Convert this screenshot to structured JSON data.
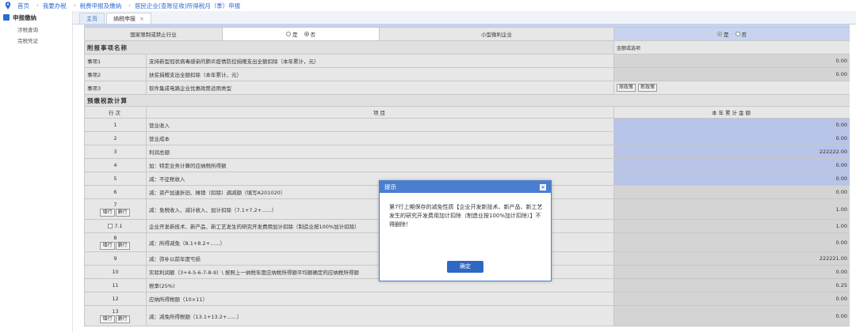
{
  "breadcrumb": [
    "首页",
    "我要办税",
    "税费申报及缴纳",
    "居民企业(查账征收)所得税月（季）申报"
  ],
  "sidebar": {
    "title": "申报缴纳",
    "items": [
      "涉税查询",
      "完税凭证"
    ]
  },
  "tabs": [
    {
      "label": "主页"
    },
    {
      "label": "纳税申报"
    }
  ],
  "form": {
    "top_row": {
      "label1": "国家限制或禁止行业",
      "yes": "是",
      "no": "否",
      "label2": "小型微利企业",
      "yes2": "是",
      "no2": "否"
    },
    "section_attach": "附报事项名称",
    "attach_amount_header": "金额或选项",
    "attach_rows": [
      {
        "code": "事项1",
        "name": "支持新型冠状病毒感染的肺炎疫情防控捐赠支出全额扣除（本年累计，元）",
        "value": "0.00"
      },
      {
        "code": "事项2",
        "name": "扶贫捐赠支出全额扣除（本年累计，元）",
        "value": "0.00"
      },
      {
        "code": "事项3",
        "name": "软件集成电路企业优惠政策适用类型",
        "opt1": "原政策",
        "opt2": "新政策"
      }
    ],
    "section_calc": "预缴税款计算",
    "calc_headers": {
      "line": "行次",
      "item": "项目",
      "amount": "本年累计金额"
    },
    "calc_rows": [
      {
        "line": "1",
        "item": "营业收入",
        "value": "0.00"
      },
      {
        "line": "2",
        "item": "营业成本",
        "value": "0.00"
      },
      {
        "line": "3",
        "item": "利润总额",
        "value": "222222.00"
      },
      {
        "line": "4",
        "item": "加：特定业务计算的应纳税所得额",
        "value": "0.00"
      },
      {
        "line": "5",
        "item": "减：不征税收入",
        "value": "0.00"
      },
      {
        "line": "6",
        "item": "减：资产加速折旧、摊销（扣除）调减额（填写A201020）",
        "value": "0.00"
      },
      {
        "line": "7",
        "item": "减：免税收入、减计收入、加计扣除（7.1+7.2+......）",
        "value": "1.00",
        "btn1": "增行",
        "btn2": "删行"
      },
      {
        "line": "7.1",
        "item": "企业开发新技术、新产品、新工艺发生的研究开发费用加计扣除（制造业按100%加计扣除）",
        "value": "1.00"
      },
      {
        "line": "8",
        "item": "减：所得减免（8.1+8.2+......）",
        "value": "0.00",
        "btn1": "增行",
        "btn2": "删行"
      },
      {
        "line": "9",
        "item": "减：弥补以前年度亏损",
        "value": "222221.00"
      },
      {
        "line": "10",
        "item": "实际利润额（3+4-5-6-7-8-9）\\ 按照上一纳税年度应纳税所得额平均额确定的应纳税所得额",
        "value": "0.00"
      },
      {
        "line": "11",
        "item": "税率(25%)",
        "value": "0.25"
      },
      {
        "line": "12",
        "item": "应纳所得税额（10×11）",
        "value": "0.00"
      },
      {
        "line": "13",
        "item": "减：减免所得税额（13.1+13.2+......）",
        "value": "0.00",
        "btn1": "增行",
        "btn2": "删行"
      }
    ]
  },
  "dialog": {
    "title": "提示",
    "message": "第7行上期保存的减免性质【企业开发新技术、新产品、新工艺发生的研究开发费用加计扣除（制造业按100%加计扣除）】不得删除！",
    "ok_label": "确定"
  },
  "colors": {
    "accent": "#2a6ad6",
    "input_blue": "#b8c4e8",
    "dialog_header": "#4a7fd0"
  }
}
